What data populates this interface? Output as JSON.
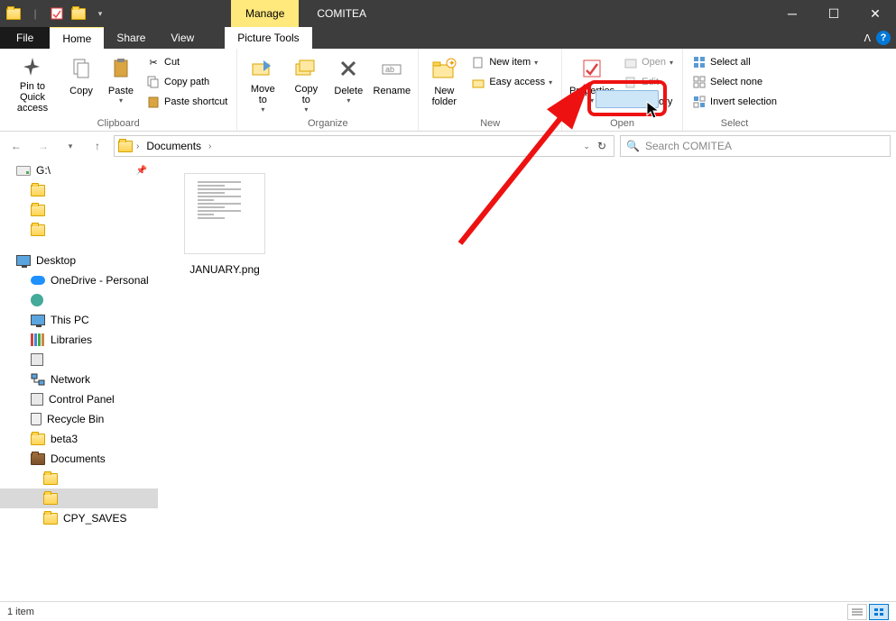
{
  "window": {
    "title": "COMITEA",
    "manage_label": "Manage"
  },
  "tabs": {
    "file": "File",
    "home": "Home",
    "share": "Share",
    "view": "View",
    "context": "Picture Tools"
  },
  "ribbon": {
    "clipboard": {
      "label": "Clipboard",
      "pin": "Pin to Quick access",
      "copy": "Copy",
      "paste": "Paste",
      "cut": "Cut",
      "copy_path": "Copy path",
      "paste_shortcut": "Paste shortcut"
    },
    "organize": {
      "label": "Organize",
      "move_to": "Move to",
      "copy_to": "Copy to",
      "delete": "Delete",
      "rename": "Rename"
    },
    "new": {
      "label": "New",
      "new_folder": "New folder",
      "new_item": "New item",
      "easy_access": "Easy access"
    },
    "open": {
      "label": "Open",
      "properties": "Properties",
      "open": "Open",
      "edit": "Edit",
      "history": "History"
    },
    "select": {
      "label": "Select",
      "select_all": "Select all",
      "select_none": "Select none",
      "invert": "Invert selection"
    }
  },
  "breadcrumb": {
    "segment1": "Documents"
  },
  "search": {
    "placeholder": "Search COMITEA"
  },
  "nav": {
    "drive": "G:\\",
    "desktop": "Desktop",
    "onedrive": "OneDrive - Personal",
    "thispc": "This PC",
    "libraries": "Libraries",
    "network": "Network",
    "control_panel": "Control Panel",
    "recycle": "Recycle Bin",
    "beta3": "beta3",
    "documents": "Documents",
    "cpy": "CPY_SAVES"
  },
  "content": {
    "file1": "JANUARY.png"
  },
  "status": {
    "count": "1 item"
  }
}
